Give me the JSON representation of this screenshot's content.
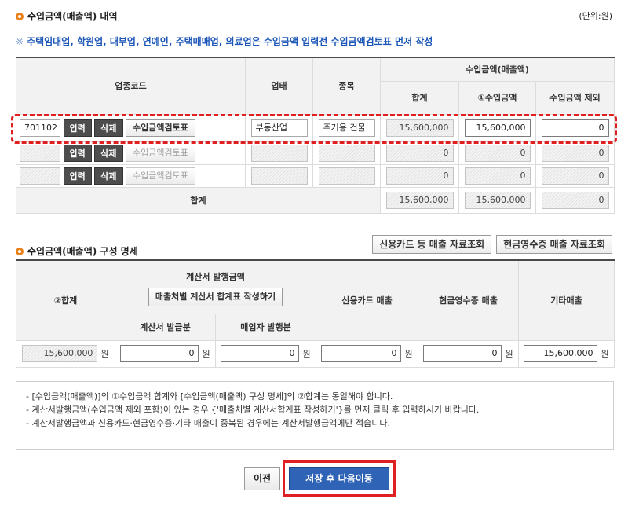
{
  "revenue": {
    "title": "수입금액(매출액) 내역",
    "unit": "(단위:원)",
    "notice_mark": "※",
    "notice": "주택임대업, 학원업, 대부업, 연예인, 주택매매업, 의료업은 수입금액 입력전 수입금액검토표 먼저 작성",
    "headers": {
      "code": "업종코드",
      "type": "업태",
      "item": "종목",
      "group": "수입금액(매출액)",
      "total": "합계",
      "income": "①수입금액",
      "excluded": "수입금액 제외"
    },
    "buttons": {
      "input": "입력",
      "delete": "삭제",
      "review": "수입금액검토표"
    },
    "rows": [
      {
        "code": "701102",
        "type": "부동산업",
        "item": "주거용 건물",
        "total": "15,600,000",
        "income": "15,600,000",
        "excluded": "0"
      },
      {
        "code": "",
        "type": "",
        "item": "",
        "total": "0",
        "income": "0",
        "excluded": "0"
      },
      {
        "code": "",
        "type": "",
        "item": "",
        "total": "0",
        "income": "0",
        "excluded": "0"
      }
    ],
    "sum": {
      "label": "합계",
      "total": "15,600,000",
      "income": "15,600,000",
      "excluded": "0"
    }
  },
  "composition": {
    "title": "수입금액(매출액) 구성 명세",
    "lookup_card": "신용카드 등 매출 자료조회",
    "lookup_cash": "현금영수증 매출 자료조회",
    "headers": {
      "total": "②합계",
      "invoice": "계산서 발행금액",
      "invoice_button": "매출처별 계산서 합계표 작성하기",
      "invoice_issued": "계산서 발급분",
      "buyer_issued": "매입자 발행분",
      "card": "신용카드 매출",
      "cash": "현금영수증 매출",
      "other": "기타매출"
    },
    "values": {
      "total": "15,600,000",
      "invoice_issued": "0",
      "buyer_issued": "0",
      "card": "0",
      "cash": "0",
      "other": "15,600,000"
    },
    "won": "원"
  },
  "info": [
    "- [수입금액(매출액)]의 ①수입금액 합계와 [수입금액(매출액) 구성 명세]의 ②합계는 동일해야 합니다.",
    "- 계산서발행금액(수입금액 제외 포함)이 있는 경우 {'매출처별 계산서합계표 작성하기'}를 먼저 클릭 후 입력하시기 바랍니다.",
    "- 계산서발행금액과 신용카드·현금영수증·기타 매출이 중복된 경우에는 계산서발행금액에만 적습니다."
  ],
  "nav": {
    "prev": "이전",
    "next": "저장 후 다음이동"
  }
}
